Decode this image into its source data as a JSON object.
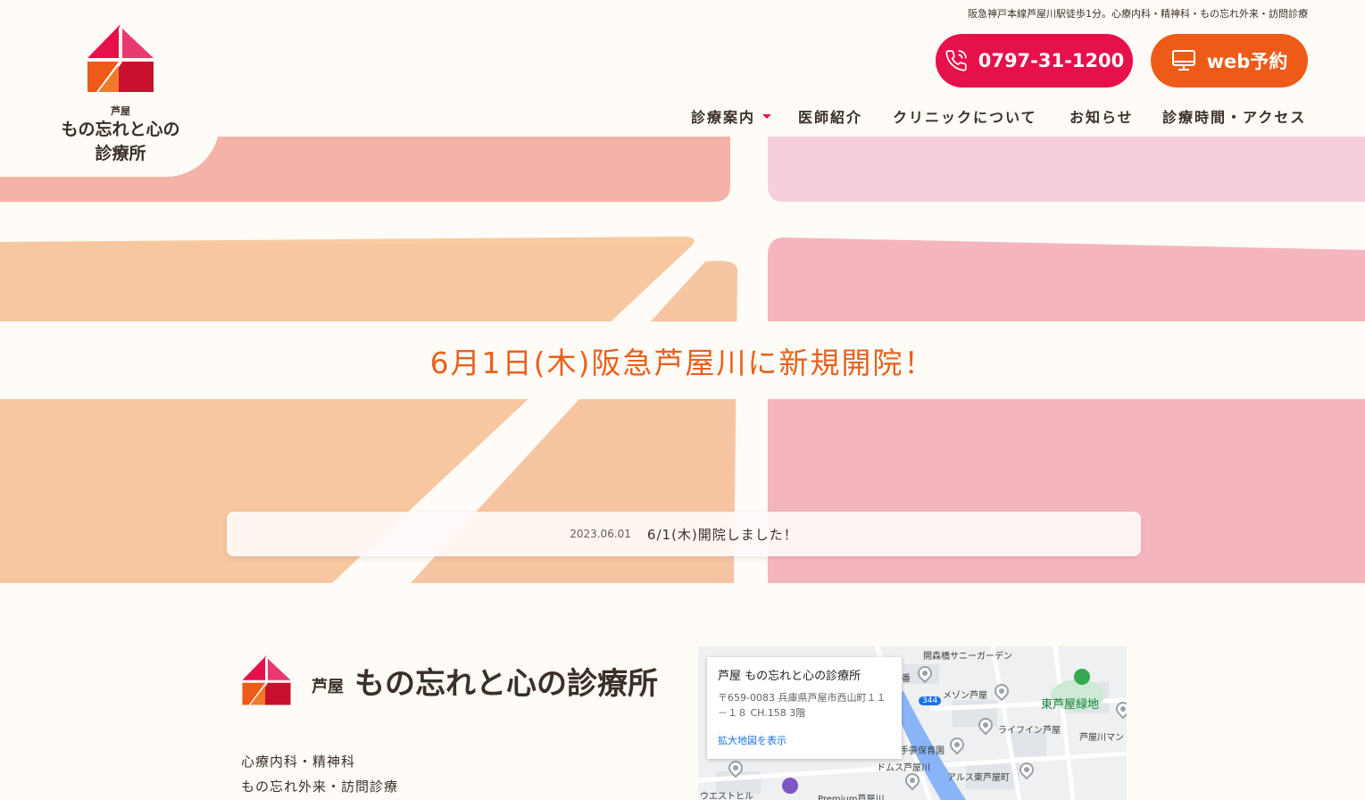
{
  "header": {
    "logo_small": "芦屋",
    "logo_line1": "もの忘れと心の",
    "logo_line2": "診療所",
    "tagline": "阪急神戸本線芦屋川駅徒歩1分。心療内科・精神科・もの忘れ外来・訪問診療",
    "tel_label": "0797-31-1200",
    "web_label": "web予約",
    "nav": [
      "診療案内",
      "医師紹介",
      "クリニックについて",
      "お知らせ",
      "診療時間・アクセス"
    ]
  },
  "hero": {
    "title": "6月1日(木)阪急芦屋川に新規開院！",
    "news_date": "2023.06.01",
    "news_text": "6/1(木)開院しました！"
  },
  "clinic": {
    "prefix": "芦屋",
    "name": "もの忘れと心の診療所",
    "departments": [
      "心療内科・精神科",
      "もの忘れ外来・訪問診療"
    ]
  },
  "map": {
    "card_title": "芦屋 もの忘れと心の診療所",
    "card_address": "〒659-0083 兵庫県芦屋市西山町１１－１８ CH.158 3階",
    "card_link": "拡大地図を表示",
    "labels": [
      "開森橋サニーガーデン",
      "メゾン芦屋",
      "東芦屋緑地",
      "ライフイン芦屋",
      "芦屋川マン",
      "手夢保育園",
      "ドムス芦屋川",
      "アルス東芦屋町",
      "ウエストヒル",
      "Premium芦屋川",
      "番",
      "344"
    ]
  },
  "colors": {
    "brand_red": "#e6104a",
    "brand_orange": "#ee5a17",
    "title_orange": "#e8611c"
  }
}
